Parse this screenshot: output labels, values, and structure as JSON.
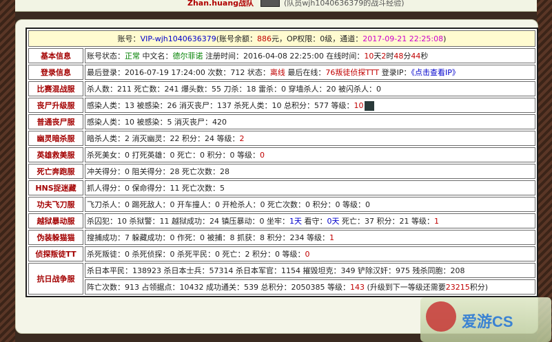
{
  "top": {
    "team": "Zhan.huang战队",
    "sub": "(队员wjh1040636379的战斗经验)"
  },
  "header": {
    "account_label": "账号：",
    "account": "VIP-wjh1040636379",
    "balance_label": "(账号余额：",
    "balance": "886",
    "balance_unit": "元，OP权限：",
    "op": "0级，通道：",
    "time": "2017-09-21 22:25:08",
    "close": ")"
  },
  "rows": [
    {
      "label": "基本信息",
      "lines": [
        [
          {
            "t": "账号状态："
          },
          {
            "t": "正常",
            "c": "gr"
          },
          {
            "t": " 中文名："
          },
          {
            "t": "德尔菲诺",
            "c": "gr"
          },
          {
            "t": " 注册时间：2016-04-08 22:25:00  在线时间："
          },
          {
            "t": "10",
            "c": "hl"
          },
          {
            "t": "天"
          },
          {
            "t": "2",
            "c": "hl"
          },
          {
            "t": "时"
          },
          {
            "t": "48",
            "c": "hl"
          },
          {
            "t": "分"
          },
          {
            "t": "44",
            "c": "hl"
          },
          {
            "t": "秒"
          }
        ]
      ]
    },
    {
      "label": "登录信息",
      "lines": [
        [
          {
            "t": "最后登录：2016-07-19 17:24:00 次数：712 状态："
          },
          {
            "t": "离线",
            "c": "hl"
          },
          {
            "t": " 最后在线："
          },
          {
            "t": "76叛徒侦探TTT",
            "c": "hl"
          },
          {
            "t": " 登录IP："
          },
          {
            "t": "《点击查看IP》",
            "c": "bl"
          }
        ]
      ]
    },
    {
      "label": "比赛混战服",
      "lines": [
        [
          {
            "t": "杀人数：211 死亡数：241 爆头数：55 刀杀：18 雷杀：0 穿墙杀人：20 被闪杀人：0"
          }
        ]
      ]
    },
    {
      "label": "丧尸升级服",
      "lines": [
        [
          {
            "t": "感染人类：13 被感染：26 消灭丧尸：137 杀死人类：10 总积分：577 等级："
          },
          {
            "t": "10",
            "c": "hl"
          },
          {
            "t": "",
            "icon": true
          }
        ]
      ]
    },
    {
      "label": "普通丧尸服",
      "lines": [
        [
          {
            "t": "感染人类：10 被感染：5 消灭丧尸：420"
          }
        ]
      ]
    },
    {
      "label": "幽灵暗杀服",
      "lines": [
        [
          {
            "t": "暗杀人类：2 消灭幽灵：22 积分：24 等级："
          },
          {
            "t": "2",
            "c": "hl"
          }
        ]
      ]
    },
    {
      "label": "英雄救美服",
      "lines": [
        [
          {
            "t": "杀死美女：0 打死英雄：0 死亡：0 积分：0 等级："
          },
          {
            "t": "0",
            "c": "hl"
          }
        ]
      ]
    },
    {
      "label": "死亡奔跑服",
      "lines": [
        [
          {
            "t": "冲关得分：0 阻关得分：28 死亡次数：28"
          }
        ]
      ]
    },
    {
      "label": "HNS捉迷藏",
      "lines": [
        [
          {
            "t": "抓人得分：0 保命得分：11 死亡次数：5"
          }
        ]
      ]
    },
    {
      "label": "功夫飞刀服",
      "lines": [
        [
          {
            "t": "飞刀杀人：0 踢死敌人：0 开车撞人：0 开枪杀人：0 死亡次数：0 积分：0 等级：0"
          }
        ]
      ]
    },
    {
      "label": "越狱暴动服",
      "lines": [
        [
          {
            "t": "杀囚犯：10 杀狱警：11 越狱成功：24 镇压暴动：0 坐牢："
          },
          {
            "t": "1天",
            "c": "bl"
          },
          {
            "t": " 看守："
          },
          {
            "t": "0天",
            "c": "bl"
          },
          {
            "t": " 死亡：37 积分：21 等级："
          },
          {
            "t": "1",
            "c": "hl"
          }
        ]
      ]
    },
    {
      "label": "伪装躲猫猫",
      "lines": [
        [
          {
            "t": "搜捕成功：7 躲藏成功：0 作死：0 被捕：8 抓获：8 积分：234 等级："
          },
          {
            "t": "1",
            "c": "hl"
          }
        ]
      ]
    },
    {
      "label": "侦探叛徒TT",
      "lines": [
        [
          {
            "t": "杀死叛徒：0 杀死侦探：0 杀死平民：0 死亡：2 积分：0 等级："
          },
          {
            "t": "0",
            "c": "hl"
          }
        ]
      ]
    },
    {
      "label": "抗日战争服",
      "lines": [
        [
          {
            "t": "杀日本平民：138923 杀日本士兵：57314 杀日本军官：1154 摧毁坦克：349 铲除汉奸：975 残杀同胞：208"
          }
        ],
        [
          {
            "t": "阵亡次数：913 占领据点：10432 成功通关：539 总积分：2050385 等级："
          },
          {
            "t": "143",
            "c": "hl"
          },
          {
            "t": " (升级到下一等级还需要"
          },
          {
            "t": "23215",
            "c": "hl"
          },
          {
            "t": "积分)"
          }
        ]
      ]
    }
  ],
  "watermark": "爱游CS"
}
